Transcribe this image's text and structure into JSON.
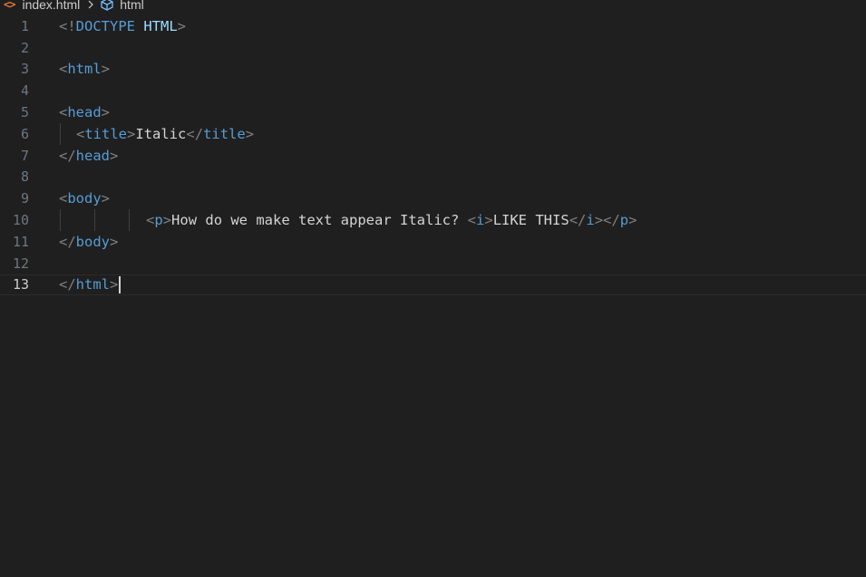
{
  "breadcrumb": {
    "file_icon": "html-file-icon",
    "file_icon_glyph": "<>",
    "file_name": "index.html",
    "separator_icon": "chevron-right-icon",
    "symbol_icon": "cube-icon",
    "symbol_name": "html"
  },
  "colors": {
    "background": "#1f1f1f",
    "tag": "#569cd6",
    "bracket": "#808080",
    "text": "#d4d4d4",
    "line_number": "#6e7681",
    "active_line_number": "#cccccc",
    "file_icon": "#e37933"
  },
  "editor": {
    "active_line": "13",
    "lines": [
      {
        "num": "1",
        "lt": "<!",
        "doctype": "DOCTYPE",
        "space": " ",
        "html_kw": "HTML",
        "gt": ">"
      },
      {
        "num": "2"
      },
      {
        "num": "3",
        "lt": "<",
        "tag": "html",
        "gt": ">"
      },
      {
        "num": "4"
      },
      {
        "num": "5",
        "lt": "<",
        "tag": "head",
        "gt": ">"
      },
      {
        "num": "6",
        "lt1": "<",
        "tag1": "title",
        "gt1": ">",
        "text": "Italic",
        "lt2": "</",
        "tag2": "title",
        "gt2": ">"
      },
      {
        "num": "7",
        "lt": "</",
        "tag": "head",
        "gt": ">"
      },
      {
        "num": "8"
      },
      {
        "num": "9",
        "lt": "<",
        "tag": "body",
        "gt": ">"
      },
      {
        "num": "10",
        "lt1": "<",
        "tag1": "p",
        "gt1": ">",
        "text1": "How do we make text appear Italic? ",
        "lt2": "<",
        "tag2": "i",
        "gt2": ">",
        "text2": "LIKE THIS",
        "lt3": "</",
        "tag3": "i",
        "gt3": ">",
        "lt4": "</",
        "tag4": "p",
        "gt4": ">"
      },
      {
        "num": "11",
        "lt": "</",
        "tag": "body",
        "gt": ">"
      },
      {
        "num": "12"
      },
      {
        "num": "13",
        "lt": "</",
        "tag": "html",
        "gt": ">"
      }
    ]
  }
}
